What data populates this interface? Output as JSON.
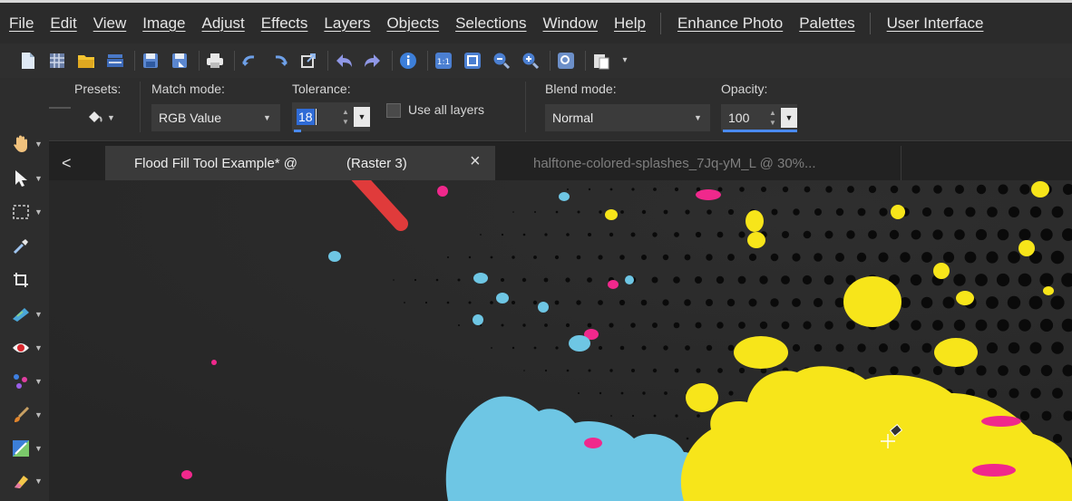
{
  "menu": {
    "items": [
      "File",
      "Edit",
      "View",
      "Image",
      "Adjust",
      "Effects",
      "Layers",
      "Objects",
      "Selections",
      "Window",
      "Help"
    ],
    "extras": [
      "Enhance Photo",
      "Palettes"
    ],
    "user_interface": "User Interface"
  },
  "toolbar": {
    "icons": [
      "new-document-icon",
      "browse-icon",
      "open-folder-icon",
      "scanner-icon",
      "save-icon",
      "save-as-icon",
      "print-icon",
      "undo-icon",
      "redo-icon",
      "resize-icon",
      "undo-history-icon",
      "redo-history-icon",
      "info-icon",
      "actual-size-icon",
      "fit-window-icon",
      "zoom-out-icon",
      "zoom-in-icon",
      "overview-icon",
      "paste-icon"
    ]
  },
  "tools": [
    "pan-hand-icon",
    "pick-arrow-icon",
    "selection-icon",
    "dropper-icon",
    "crop-icon",
    "straighten-icon",
    "red-eye-icon",
    "clone-icon",
    "paint-brush-icon",
    "color-replacer-icon",
    "eraser-icon"
  ],
  "options": {
    "presets_label": "Presets:",
    "match_mode_label": "Match mode:",
    "match_mode_value": "RGB Value",
    "tolerance_label": "Tolerance:",
    "tolerance_value": "18",
    "use_all_layers_label": "Use all layers",
    "blend_mode_label": "Blend mode:",
    "blend_mode_value": "Normal",
    "opacity_label": "Opacity:",
    "opacity_value": "100"
  },
  "tabs": {
    "back_glyph": "<",
    "active_title": "Flood Fill Tool Example* @",
    "active_layer": "(Raster 3)",
    "close_glyph": "×",
    "inactive_title": "halftone-colored-splashes_7Jq-yM_L  @   30%..."
  },
  "colors": {
    "accent_orange": "#e8612c",
    "arrow_red": "#e03b3b",
    "splash_yellow": "#f7e51a",
    "splash_cyan": "#6ec6e4",
    "splash_magenta": "#f0288c",
    "field_highlight": "#2f6bd6"
  }
}
